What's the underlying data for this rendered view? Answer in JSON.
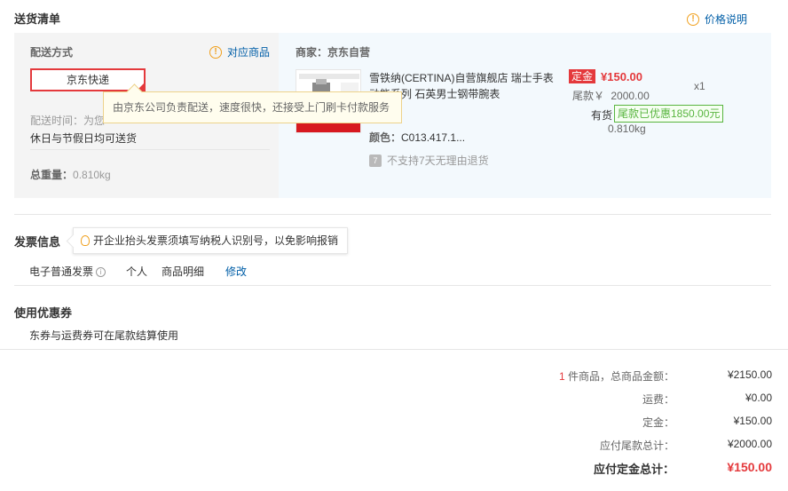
{
  "header": {
    "title": "送货清单",
    "price_note": "价格说明"
  },
  "shipping": {
    "label": "配送方式",
    "related_products": "对应商品",
    "selected_option": "京东快递",
    "time_line1": "配送时间：为您",
    "time_line2": "休日与节假日均可送货",
    "weight_label": "总重量：",
    "weight_value": "0.810kg",
    "tooltip": "由京东公司负责配送，速度很快，还接受上门刷卡付款服务"
  },
  "merchant": {
    "label": "商家：京东自营"
  },
  "product": {
    "title": "雪铁纳(CERTINA)自营旗舰店 瑞士手表",
    "title2": "动能系列 石英男士钢带腕表",
    "color_label": "颜色：",
    "color_value": "C013.417.1...",
    "no_return_text": "不支持7天无理由退货",
    "no_return_icon_char": "7",
    "deposit_tag": "定金",
    "deposit_price": "¥150.00",
    "balance_label": "尾款￥",
    "balance_value": "2000.00",
    "stock_label": "有货",
    "discount_badge": "尾款已优惠1850.00元",
    "weight": "0.810kg",
    "quantity": "x1"
  },
  "invoice": {
    "title": "发票信息",
    "tip": "开企业抬头发票须填写纳税人识别号，以免影响报销",
    "type": "电子普通发票",
    "info_icon_char": "i",
    "holder": "个人",
    "content": "商品明细",
    "edit_link": "修改"
  },
  "coupon": {
    "title": "使用优惠券",
    "note": "东券与运费券可在尾款结算使用"
  },
  "summary": {
    "item_count": "1",
    "item_count_suffix": "件商品，总商品金额：",
    "total_goods": "¥2150.00",
    "shipping_label": "运费：",
    "shipping_value": "¥0.00",
    "deposit_label": "定金：",
    "deposit_value": "¥150.00",
    "balance_label": "应付尾款总计：",
    "balance_value": "¥2000.00",
    "deposit_total_label": "应付定金总计：",
    "deposit_total_value": "¥150.00"
  },
  "colors": {
    "accent_red": "#e4393c",
    "link_blue": "#005ea7",
    "warning_orange": "#f0a01e",
    "discount_green": "#58b53f"
  },
  "icons": {
    "warning": "!"
  }
}
